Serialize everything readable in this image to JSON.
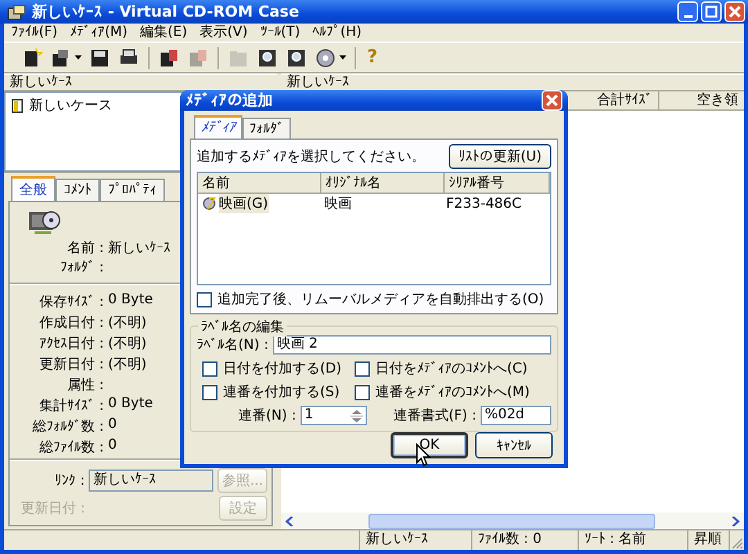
{
  "window": {
    "title": "新しいｹｰｽ - Virtual CD-ROM Case"
  },
  "menu": [
    "ﾌｧｲﾙ(F)",
    "ﾒﾃﾞｨｱ(M)",
    "編集(E)",
    "表示(V)",
    "ﾂｰﾙ(T)",
    "ﾍﾙﾌﾟ(H)"
  ],
  "toolbar": [
    {
      "kind": "new",
      "dropdown": false,
      "disabled": false
    },
    {
      "kind": "open",
      "dropdown": true,
      "disabled": false
    },
    {
      "kind": "save",
      "dropdown": false,
      "disabled": false
    },
    {
      "kind": "print",
      "dropdown": false,
      "disabled": false
    },
    {
      "kind": "separator"
    },
    {
      "kind": "media",
      "dropdown": false,
      "disabled": false
    },
    {
      "kind": "media",
      "dropdown": false,
      "disabled": true
    },
    {
      "kind": "separator"
    },
    {
      "kind": "folder",
      "dropdown": false,
      "disabled": true
    },
    {
      "kind": "find",
      "dropdown": false,
      "disabled": false
    },
    {
      "kind": "find",
      "dropdown": false,
      "disabled": false
    },
    {
      "kind": "disc",
      "dropdown": true,
      "disabled": false
    },
    {
      "kind": "separator"
    },
    {
      "kind": "help",
      "glyph": "?"
    }
  ],
  "left": {
    "header": "新しいｹｰｽ",
    "tree": [
      {
        "label": "新しいケース"
      }
    ],
    "tabs": [
      {
        "label": "全般",
        "selected": true
      },
      {
        "label": "ｺﾒﾝﾄ",
        "selected": false
      },
      {
        "label": "ﾌﾟﾛﾊﾟﾃｨ",
        "selected": false
      }
    ],
    "name_rows": [
      {
        "label": "名前 :",
        "value": "新しいｹｰｽ"
      },
      {
        "label": "ﾌｫﾙﾀﾞ :"
      }
    ],
    "detail_rows": [
      {
        "label": "保存ｻｲｽﾞ :",
        "value": "0 Byte"
      },
      {
        "label": "作成日付 :",
        "value": "(不明)"
      },
      {
        "label": "ｱｸｾｽ日付 :",
        "value": "(不明)"
      },
      {
        "label": "更新日付 :",
        "value": "(不明)"
      },
      {
        "label": "属性 :"
      },
      {
        "label": "集計ｻｲｽﾞ :",
        "value": "0 Byte"
      },
      {
        "label": "総ﾌｫﾙﾀﾞ数 :",
        "value": "0"
      },
      {
        "label": "総ﾌｧｲﾙ数 :",
        "value": "0"
      }
    ],
    "link": {
      "label": "ﾘﾝｸ :",
      "value": "新しいｹｰｽ",
      "button": "参照...",
      "button_disabled": true
    },
    "updated": {
      "label": "更新日付 :",
      "disabled": true,
      "button": "設定",
      "button_disabled": true
    }
  },
  "right": {
    "header": "新しいｹｰｽ",
    "columns": [
      "合計ｻｲｽﾞ",
      "空き領"
    ]
  },
  "status_bar": [
    "新しいｹｰｽ",
    "ﾌｧｲﾙ数 : 0",
    "ｿｰﾄ : 名前",
    "昇順"
  ],
  "dialog": {
    "title": "ﾒﾃﾞｨｱの追加",
    "tabs": [
      {
        "label": "ﾒﾃﾞｨｱ",
        "selected": true
      },
      {
        "label": "ﾌｫﾙﾀﾞ",
        "selected": false
      }
    ],
    "prompt": "追加するﾒﾃﾞｨｱを選択してください。",
    "refresh_button": "ﾘｽﾄの更新(U)",
    "columns": [
      "名前",
      "ｵﾘｼﾞﾅﾙ名",
      "ｼﾘｱﾙ番号"
    ],
    "rows": [
      {
        "cells": [
          "映画(G)",
          "映画",
          "F233-486C"
        ],
        "selected": true
      }
    ],
    "eject": {
      "label": "追加完了後、リムーバルメディアを自動排出する(O)",
      "checked": false
    },
    "group": {
      "title": "ﾗﾍﾞﾙ名の編集",
      "label_name": {
        "label": "ﾗﾍﾞﾙ名(N) :",
        "value": "映画 2"
      },
      "options": [
        {
          "label": "日付を付加する(D)",
          "checked": false
        },
        {
          "label": "日付をﾒﾃﾞｨｱのｺﾒﾝﾄへ(C)",
          "checked": false
        },
        {
          "label": "連番を付加する(S)",
          "checked": false
        },
        {
          "label": "連番をﾒﾃﾞｨｱのｺﾒﾝﾄへ(M)",
          "checked": false
        }
      ],
      "number": {
        "label": "連番(N) :",
        "value": "1"
      },
      "format": {
        "label": "連番書式(F) :",
        "value": "%02d"
      }
    },
    "buttons": [
      {
        "label": "OK",
        "default": true
      },
      {
        "label": "ｷｬﾝｾﾙ",
        "default": false
      }
    ]
  }
}
